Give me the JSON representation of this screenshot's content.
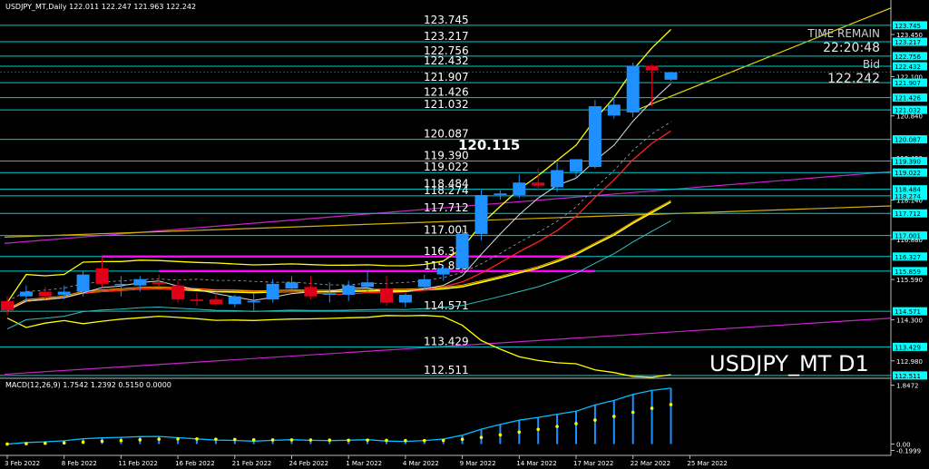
{
  "header": "USDJPY_MT,Daily  122.011 122.247 121.963 122.242",
  "symbol_watermark": "USDJPY_MT D1",
  "time_remain_label": "TIME REMAIN",
  "time_remain_value": "22:20:48",
  "bid_label": "Bid",
  "bid_value": "122.242",
  "highlight_label": "120.115",
  "macd_label": "MACD(12,26,9) 1.7542 1.2392 0.5150 0.0000",
  "colors": {
    "background": "#000000",
    "bull_candle": "#1e90ff",
    "bear_candle": "#e0001a",
    "level_line": "#00ced1",
    "level_label_bg": "#00ffff",
    "bollinger": "#ffff00",
    "trend_line": "#cc22cc",
    "macd_main": "#00bfff",
    "macd_signal": "#ffff00",
    "ma_red": "#ff2020",
    "ma_orange": "#ffa500",
    "ma_white": "#dddddd"
  },
  "chart_data": [
    {
      "type": "candlestick",
      "symbol": "USDJPY_MT",
      "timeframe": "Daily",
      "price_axis": {
        "ylim": [
          112.45,
          124.15
        ],
        "ticks": [
          "123.450",
          "122.100",
          "120.840",
          "119.490",
          "118.140",
          "116.880",
          "115.590",
          "114.300",
          "112.980"
        ],
        "tick_values": [
          123.45,
          122.1,
          120.84,
          119.49,
          118.14,
          116.88,
          115.59,
          114.3,
          112.98
        ]
      },
      "time_axis": {
        "labels": [
          "3 Feb 2022",
          "8 Feb 2022",
          "11 Feb 2022",
          "16 Feb 2022",
          "21 Feb 2022",
          "24 Feb 2022",
          "1 Mar 2022",
          "4 Mar 2022",
          "9 Mar 2022",
          "14 Mar 2022",
          "17 Mar 2022",
          "22 Mar 2022",
          "25 Mar 2022"
        ],
        "label_positions": [
          0,
          3,
          6,
          9,
          12,
          15,
          18,
          21,
          24,
          27,
          30,
          33,
          36
        ]
      },
      "candles": [
        {
          "o": 114.9,
          "h": 115.05,
          "l": 114.45,
          "c": 114.6
        },
        {
          "o": 115.05,
          "h": 115.4,
          "l": 114.85,
          "c": 115.2
        },
        {
          "o": 115.2,
          "h": 115.35,
          "l": 114.95,
          "c": 115.05
        },
        {
          "o": 115.1,
          "h": 115.4,
          "l": 114.95,
          "c": 115.2
        },
        {
          "o": 115.2,
          "h": 115.85,
          "l": 115.05,
          "c": 115.75
        },
        {
          "o": 115.95,
          "h": 116.3,
          "l": 115.35,
          "c": 115.45
        },
        {
          "o": 115.45,
          "h": 115.7,
          "l": 115.05,
          "c": 115.45
        },
        {
          "o": 115.4,
          "h": 115.7,
          "l": 115.2,
          "c": 115.6
        },
        {
          "o": 115.5,
          "h": 115.75,
          "l": 115.35,
          "c": 115.45
        },
        {
          "o": 115.4,
          "h": 115.55,
          "l": 114.85,
          "c": 114.95
        },
        {
          "o": 114.95,
          "h": 115.15,
          "l": 114.75,
          "c": 114.9
        },
        {
          "o": 114.95,
          "h": 115.15,
          "l": 114.75,
          "c": 114.8
        },
        {
          "o": 114.8,
          "h": 115.1,
          "l": 114.7,
          "c": 115.05
        },
        {
          "o": 114.9,
          "h": 115.15,
          "l": 114.6,
          "c": 114.9
        },
        {
          "o": 114.95,
          "h": 115.6,
          "l": 114.85,
          "c": 115.45
        },
        {
          "o": 115.3,
          "h": 115.7,
          "l": 115.2,
          "c": 115.5
        },
        {
          "o": 115.35,
          "h": 115.7,
          "l": 114.95,
          "c": 115.05
        },
        {
          "o": 115.1,
          "h": 115.5,
          "l": 114.85,
          "c": 115.15
        },
        {
          "o": 115.1,
          "h": 115.55,
          "l": 114.9,
          "c": 115.4
        },
        {
          "o": 115.35,
          "h": 115.9,
          "l": 115.2,
          "c": 115.5
        },
        {
          "o": 115.3,
          "h": 115.7,
          "l": 114.75,
          "c": 114.85
        },
        {
          "o": 114.85,
          "h": 115.15,
          "l": 114.7,
          "c": 115.1
        },
        {
          "o": 115.35,
          "h": 115.75,
          "l": 115.25,
          "c": 115.6
        },
        {
          "o": 115.75,
          "h": 116.05,
          "l": 115.55,
          "c": 115.95
        },
        {
          "o": 115.95,
          "h": 117.2,
          "l": 115.85,
          "c": 117.05
        },
        {
          "o": 117.05,
          "h": 118.45,
          "l": 116.85,
          "c": 118.3
        },
        {
          "o": 118.3,
          "h": 118.45,
          "l": 118.15,
          "c": 118.35
        },
        {
          "o": 118.3,
          "h": 118.95,
          "l": 118.2,
          "c": 118.7
        },
        {
          "o": 118.7,
          "h": 119.15,
          "l": 118.45,
          "c": 118.6
        },
        {
          "o": 118.55,
          "h": 119.35,
          "l": 118.4,
          "c": 119.1
        },
        {
          "o": 119.05,
          "h": 119.45,
          "l": 118.85,
          "c": 119.45
        },
        {
          "o": 119.2,
          "h": 121.35,
          "l": 119.15,
          "c": 121.15
        },
        {
          "o": 120.85,
          "h": 121.45,
          "l": 120.75,
          "c": 121.2
        },
        {
          "o": 120.95,
          "h": 122.55,
          "l": 120.8,
          "c": 122.45
        },
        {
          "o": 122.45,
          "h": 122.5,
          "l": 121.15,
          "c": 122.3
        },
        {
          "o": 122.0,
          "h": 122.25,
          "l": 121.96,
          "c": 122.24
        }
      ],
      "horizontal_levels": [
        123.745,
        123.217,
        122.756,
        122.432,
        121.907,
        121.426,
        121.032,
        120.087,
        119.39,
        119.022,
        118.484,
        118.274,
        117.712,
        117.001,
        116.327,
        115.859,
        114.571,
        113.429,
        112.511
      ],
      "level_labels": [
        "123.745",
        "123.217",
        "122.756",
        "122.432",
        "121.907",
        "121.426",
        "121.032",
        "120.087",
        "119.390",
        "119.022",
        "118.484",
        "118.274",
        "117.712",
        "117.001",
        "116.327",
        "115.859",
        "114.571",
        "113.429",
        "112.511"
      ],
      "support_resistance_zones": [
        {
          "price": 116.327,
          "from": 5,
          "to": 30
        },
        {
          "price": 115.859,
          "from": 8,
          "to": 31
        }
      ],
      "last_price": 122.242
    },
    {
      "type": "bar",
      "name": "MACD(12,26,9)",
      "values_shown": {
        "main": 1.7542,
        "signal": 1.2392,
        "histogram": 0.515,
        "zero": 0.0
      },
      "ylim": [
        -0.3,
        1.95
      ],
      "ticks": [
        "1.8472",
        "0.00",
        "-0.1999"
      ],
      "tick_values": [
        1.8472,
        0.0,
        -0.1999
      ]
    }
  ]
}
